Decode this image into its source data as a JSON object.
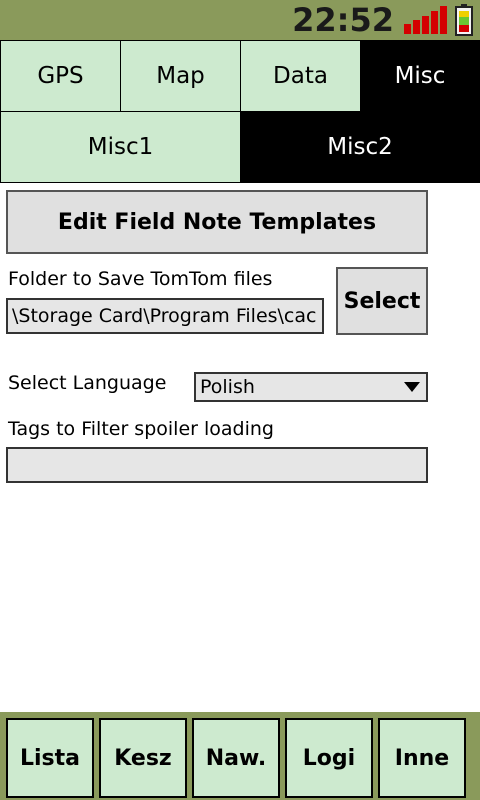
{
  "status_bar": {
    "time": "22:52",
    "signal_icon": "signal-bars-icon",
    "battery_icon": "battery-icon"
  },
  "tabs_row1": [
    {
      "label": "GPS",
      "active": false
    },
    {
      "label": "Map",
      "active": false
    },
    {
      "label": "Data",
      "active": false
    },
    {
      "label": "Misc",
      "active": true
    }
  ],
  "tabs_row2": [
    {
      "label": "Misc1",
      "active": false
    },
    {
      "label": "Misc2",
      "active": true
    }
  ],
  "content": {
    "edit_templates_label": "Edit Field Note Templates",
    "tomtom_folder_label": "Folder to Save TomTom files",
    "tomtom_folder_value": "\\Storage Card\\Program Files\\cac",
    "select_button_label": "Select",
    "language_label": "Select Language",
    "language_value": "Polish",
    "spoiler_tags_label": "Tags to Filter spoiler loading",
    "spoiler_tags_value": ""
  },
  "bottom_nav": [
    "Lista",
    "Kesz",
    "Naw.",
    "Logi",
    "Inne"
  ],
  "colors": {
    "bar": "#8a9a5b",
    "tab_inactive": "#cdeacf",
    "tab_active": "#000000",
    "button": "#e0e0e0"
  }
}
